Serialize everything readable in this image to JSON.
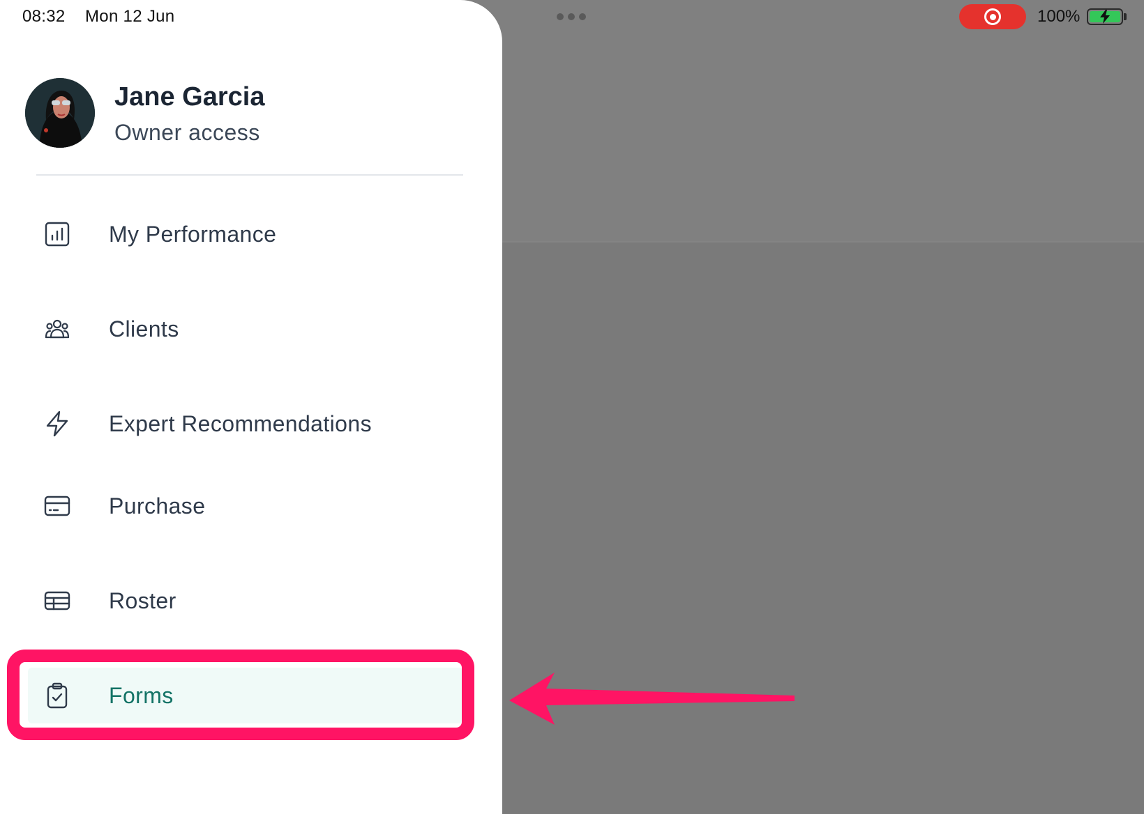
{
  "status_bar": {
    "time": "08:32",
    "date": "Mon 12 Jun",
    "battery_percent": "100%",
    "recording_color": "#e5322d"
  },
  "profile": {
    "name": "Jane Garcia",
    "role": "Owner access"
  },
  "menu": {
    "items": [
      {
        "label": "My Performance",
        "icon": "bar-chart-icon"
      },
      {
        "label": "Clients",
        "icon": "users-icon"
      },
      {
        "label": "Expert Recommendations",
        "icon": "lightning-icon"
      },
      {
        "label": "Purchase",
        "icon": "credit-card-icon"
      },
      {
        "label": "Roster",
        "icon": "table-icon"
      },
      {
        "label": "Forms",
        "icon": "clipboard-check-icon",
        "active": true
      }
    ],
    "active_color": "#137366"
  },
  "annotation": {
    "color": "#ff1464",
    "highlighted_item": "Forms"
  }
}
